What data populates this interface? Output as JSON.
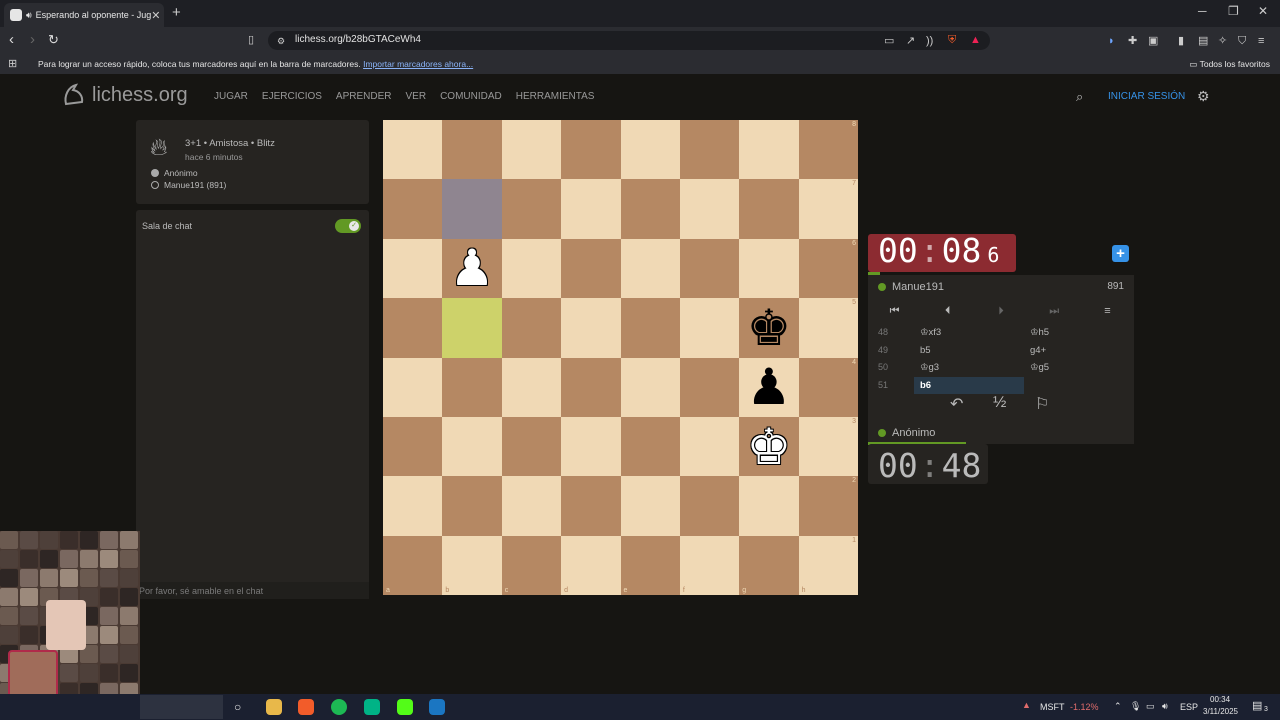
{
  "browser": {
    "tab_title": "Esperando al oponente - Jug",
    "url": "lichess.org/b28bGTACeWh4",
    "bookmarks_hint": "Para lograr un acceso rápido, coloca tus marcadores aquí en la barra de marcadores.",
    "bookmarks_import": "Importar marcadores ahora...",
    "bookmarks_all": "Todos los favoritos"
  },
  "site": {
    "logo": "lichess.org",
    "nav": [
      "JUGAR",
      "EJERCICIOS",
      "APRENDER",
      "VER",
      "COMUNIDAD",
      "HERRAMIENTAS"
    ],
    "signin": "INICIAR SESIÓN"
  },
  "game": {
    "title": "3+1 • Amistosa • Blitz",
    "time_ago": "hace 6 minutos",
    "white_player": "Anónimo",
    "black_player": "Manue191 (891)"
  },
  "chat": {
    "title": "Sala de chat",
    "placeholder": "Por favor, sé amable en el chat"
  },
  "clock_top": {
    "minutes": "00",
    "seconds": "08",
    "tenths": "6"
  },
  "clock_bottom": {
    "minutes": "00",
    "seconds": "48"
  },
  "player_top": {
    "name": "Manue191",
    "rating": "891"
  },
  "player_bottom": {
    "name": "Anónimo"
  },
  "moves": [
    {
      "no": "48",
      "white": "♔xf3",
      "black": "♔h5"
    },
    {
      "no": "49",
      "white": "b5",
      "black": "g4+"
    },
    {
      "no": "50",
      "white": "♔g3",
      "black": "♔g5"
    },
    {
      "no": "51",
      "white": "b6",
      "black": ""
    }
  ],
  "draw_symbol": "½",
  "board": {
    "files": [
      "a",
      "b",
      "c",
      "d",
      "e",
      "f",
      "g",
      "h"
    ],
    "ranks": [
      "8",
      "7",
      "6",
      "5",
      "4",
      "3",
      "2",
      "1"
    ],
    "pieces": [
      {
        "square": "b6",
        "glyph": "♟",
        "color": "white"
      },
      {
        "square": "g5",
        "glyph": "♚",
        "color": "black"
      },
      {
        "square": "g4",
        "glyph": "♟",
        "color": "black"
      },
      {
        "square": "g3",
        "glyph": "♚",
        "color": "white"
      }
    ],
    "highlight_from": "b7",
    "highlight_to": "b5"
  },
  "taskbar": {
    "stock": "MSFT",
    "stock_change": "-1.12%",
    "lang": "ESP",
    "time": "00:34",
    "date": "3/11/2025",
    "notif_count": "3"
  }
}
